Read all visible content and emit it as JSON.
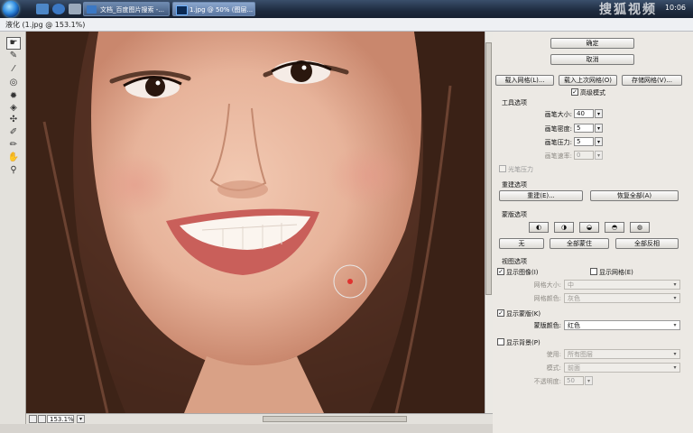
{
  "taskbar": {
    "tabs": [
      "文档_百度图片搜索 -...",
      "1.jpg @ 50% (图层..."
    ],
    "watermark": "搜狐视频",
    "clock": "10:06"
  },
  "window": {
    "title": "液化 (1.jpg @ 153.1%)"
  },
  "tools": [
    "warp-tool",
    "reconstruct-tool",
    "smooth-tool",
    "twirl-tool",
    "pucker-tool",
    "bloat-tool",
    "push-left-tool",
    "freeze-mask-tool",
    "thaw-mask-tool",
    "hand-tool",
    "zoom-tool"
  ],
  "status": {
    "zoom": "153.1%"
  },
  "panel": {
    "ok": "确定",
    "cancel": "取消",
    "load_mesh": "载入网格(L)...",
    "load_last_mesh": "载入上次网格(O)",
    "save_mesh": "存储网格(V)...",
    "advanced_mode": "高级模式",
    "tool_options": {
      "title": "工具选项",
      "brush_size_label": "画笔大小:",
      "brush_size": "40",
      "brush_density_label": "画笔密度:",
      "brush_density": "5",
      "brush_pressure_label": "画笔压力:",
      "brush_pressure": "5",
      "brush_rate_label": "画笔速率:",
      "brush_rate": "0",
      "stylus_pressure": "光笔压力"
    },
    "reconstruct": {
      "title": "重建选项",
      "rebuild": "重建(E)...",
      "restore_all": "恢复全部(A)"
    },
    "mask": {
      "title": "蒙版选项",
      "none": "无",
      "mask_all": "全部蒙住",
      "invert_all": "全部反相"
    },
    "view": {
      "title": "视图选项",
      "show_image": "显示图像(I)",
      "show_mesh": "显示网格(E)",
      "mesh_size_label": "网格大小:",
      "mesh_size": "中",
      "mesh_color_label": "网格颜色:",
      "mesh_color": "灰色",
      "show_mask": "显示蒙版(K)",
      "mask_color_label": "蒙版颜色:",
      "mask_color": "红色",
      "show_backdrop": "显示背景(P)",
      "use_label": "使用:",
      "use_value": "所有图层",
      "mode_label": "模式:",
      "mode_value": "前面",
      "opacity_label": "不透明度:",
      "opacity_value": "50"
    }
  }
}
